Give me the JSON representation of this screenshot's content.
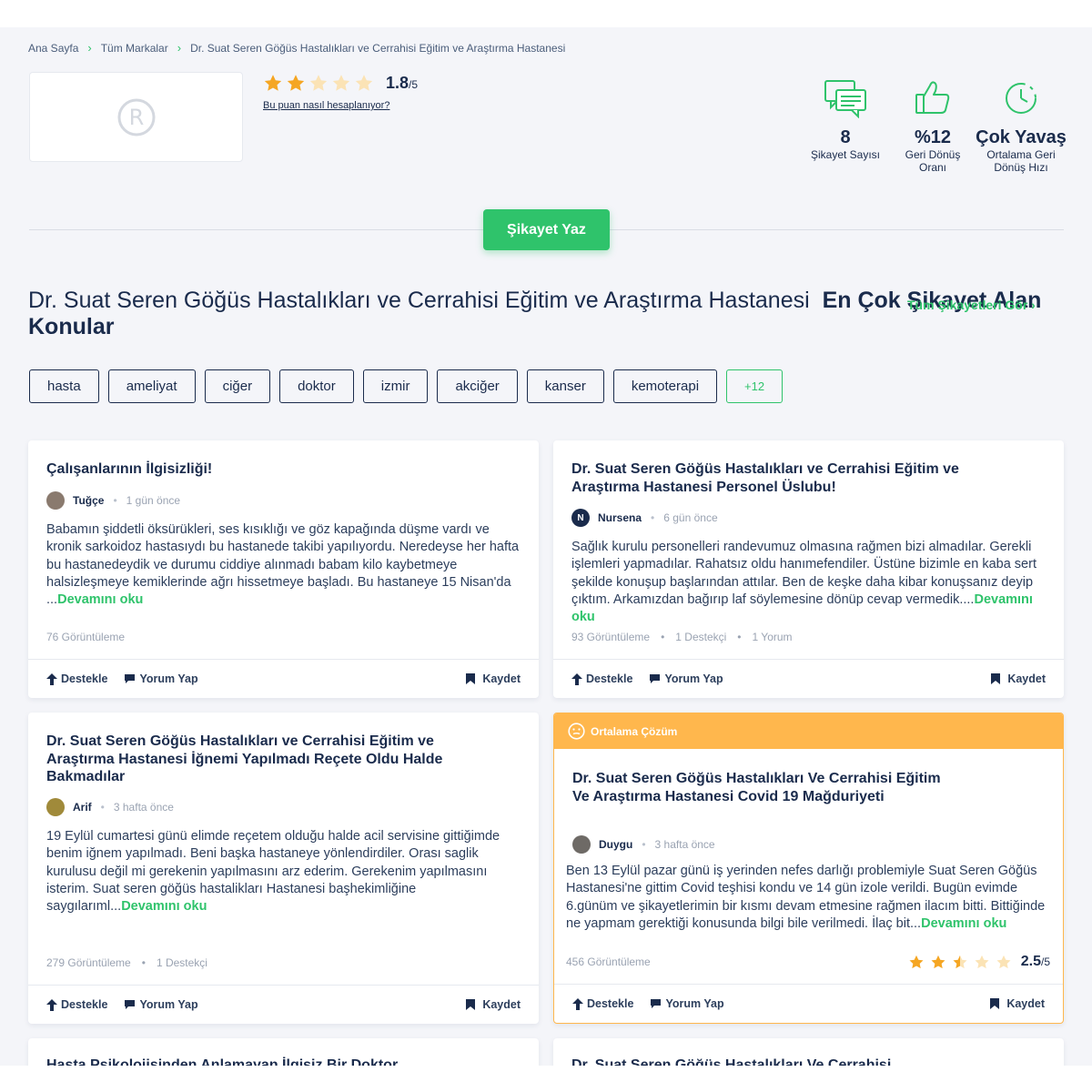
{
  "breadcrumb": [
    "Ana Sayfa",
    "Tüm Markalar",
    "Dr. Suat Seren Göğüs Hastalıkları ve Cerrahisi Eğitim ve Araştırma Hastanesi"
  ],
  "brand": {
    "rating": "1.8",
    "rating_max": "/5",
    "rating_stars_filled": 2,
    "how_calculated": "Bu puan nasıl hesaplanıyor?"
  },
  "stats": [
    {
      "icon": "complaints-icon",
      "value": "8",
      "label_lines": [
        "Şikayet Sayısı"
      ]
    },
    {
      "icon": "thumbs-up-icon",
      "value": "%12",
      "label_lines": [
        "Geri Dönüş",
        "Oranı"
      ]
    },
    {
      "icon": "stopwatch-icon",
      "value": "Çok Yavaş",
      "label_lines": [
        "Ortalama Geri",
        "Dönüş Hızı"
      ]
    }
  ],
  "write_button": "Şikayet Yaz",
  "section": {
    "brand_name": "Dr. Suat Seren Göğüs Hastalıkları ve Cerrahisi Eğitim ve Araştırma Hastanesi",
    "title_bold": "En Çok Şikayet Alan Konular",
    "all_link": "Tüm Şikayetleri Gör"
  },
  "tags": [
    "hasta",
    "ameliyat",
    "ciğer",
    "doktor",
    "izmir",
    "akciğer",
    "kanser",
    "kemoterapi"
  ],
  "tags_more": "+12",
  "actions": {
    "support": "Destekle",
    "comment": "Yorum Yap",
    "save": "Kaydet"
  },
  "colors": {
    "accent": "#2fc36b",
    "navy": "#1a2b4c",
    "orange": "#ffb74d",
    "star": "#f5a623"
  },
  "complaints": [
    {
      "title": "Çalışanlarının İlgisizliği!",
      "user": "Tuğçe",
      "time": "1 gün önce",
      "body": "Babamın şiddetli öksürükleri, ses kısıklığı ve göz kapağında düşme vardı ve kronik sarkoidoz hastasıydı bu hastanede takibi yapılıyordu. Neredeyse her hafta bu hastanedeydik ve durumu ciddiye alınmadı babam kilo kaybetmeye halsizleşmeye kemiklerinde ağrı hissetmeye başladı. Bu hastaneye 15 Nisan'da ...",
      "more": "Devamını oku",
      "views": "76 Görüntüleme"
    },
    {
      "title": "Dr. Suat Seren Göğüs Hastalıkları ve Cerrahisi Eğitim ve Araştırma Hastanesi Personel Üslubu!",
      "user": "Nursena",
      "avatar_letter": "N",
      "time": "6 gün önce",
      "body": "Sağlık kurulu personelleri randevumuz olmasına rağmen bizi almadılar. Gerekli işlemleri yapmadılar. Rahatsız oldu hanımefendiler. Üstüne bizimle en kaba sert şekilde konuşup başlarından attılar. Ben de keşke daha kibar konuşsanız deyip çıktım. Arkamızdan bağırıp laf söylemesine dönüp cevap vermedik....",
      "more": "Devamını oku",
      "views": "93 Görüntüleme",
      "supporters": "1 Destekçi",
      "comments": "1 Yorum"
    },
    {
      "title": "Dr. Suat Seren Göğüs Hastalıkları ve Cerrahisi Eğitim ve Araştırma Hastanesi İğnemi Yapılmadı Reçete Oldu Halde Bakmadılar",
      "user": "Arif",
      "time": "3 hafta önce",
      "body": "19 Eylül cumartesi günü elimde reçetem olduğu halde acil servisine gittiğimde benim iğnem yapılmadı. Beni başka hastaneye yönlendirdiler. Orası saglik kurulusu değil mi gerekenin yapılmasını arz ederim. Gerekenim yapılmasını isterim. Suat seren göğüs hastalikları Hastanesi başhekimliğine saygılarıml...",
      "more": "Devamını oku",
      "views": "279 Görüntüleme",
      "supporters": "1 Destekçi"
    },
    {
      "badge": "Ortalama Çözüm",
      "title": "Dr. Suat Seren Göğüs Hastalıkları Ve Cerrahisi Eğitim Ve Araştırma Hastanesi Covid 19 Mağduriyeti",
      "user": "Duygu",
      "time": "3 hafta önce",
      "body": "Ben 13 Eylül pazar günü iş yerinden nefes darlığı problemiyle Suat Seren Göğüs Hastanesi'ne gittim Covid teşhisi kondu ve 14 gün izole verildi. Bugün evimde 6.günüm ve şikayetlerimin bir kısmı devam etmesine rağmen ilacım bitti. Bittiğinde ne yapmam gerektiği konusunda bilgi bile verilmedi. İlaç bit...",
      "more": "Devamını oku",
      "views": "456 Görüntüleme",
      "rating": "2.5",
      "rating_max": "/5",
      "rating_stars": 2.5
    },
    {
      "title": "Hasta Psikolojisinden Anlamayan İlgisiz Bir Doktor"
    },
    {
      "title": "Dr. Suat Seren Göğüs Hastalıkları Ve Cerrahisi"
    }
  ]
}
